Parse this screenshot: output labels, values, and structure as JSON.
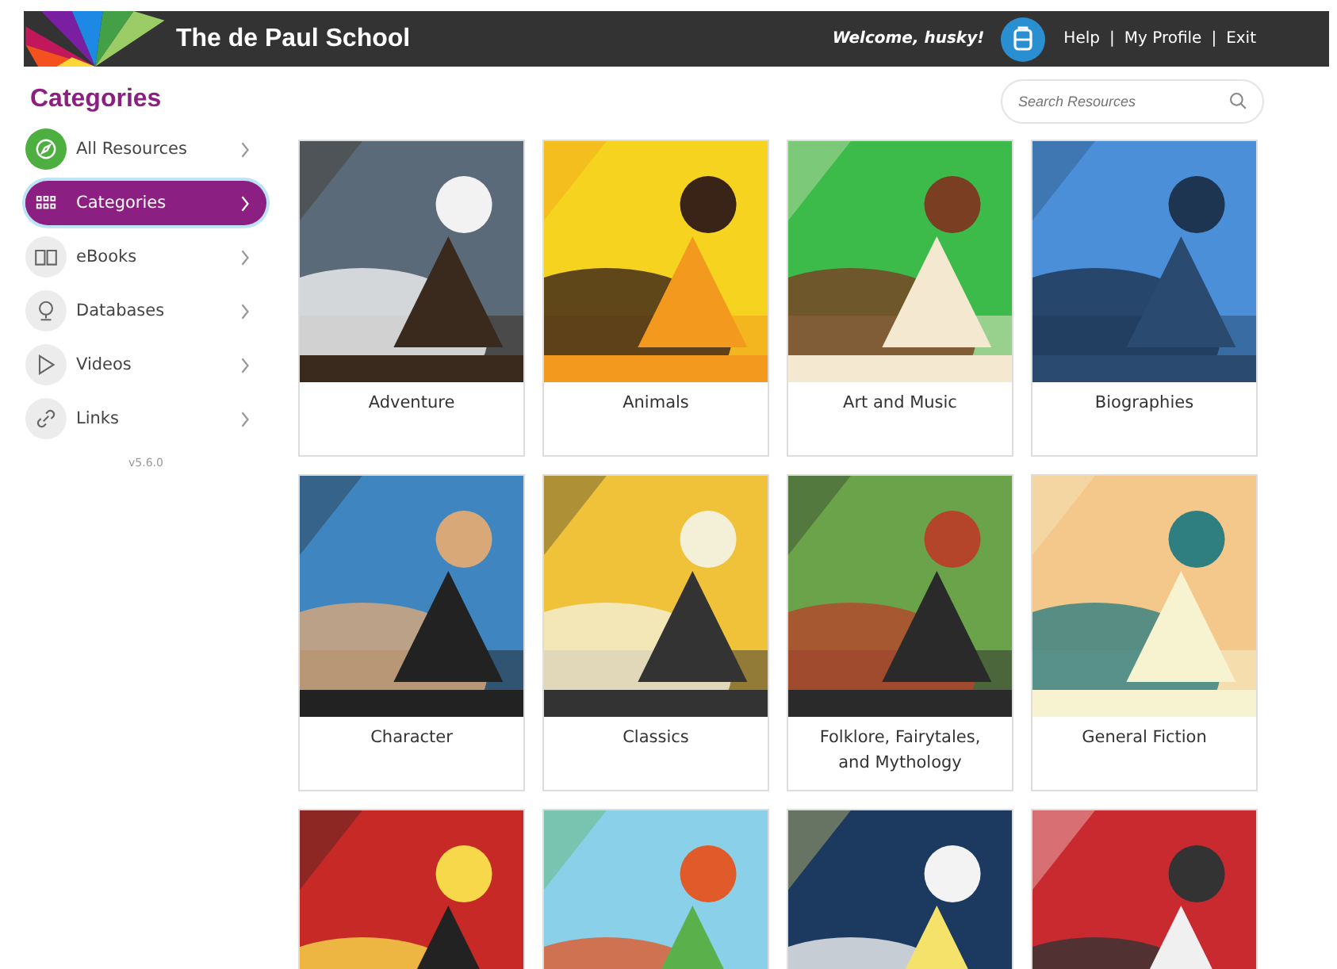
{
  "header": {
    "title": "The de Paul School",
    "welcome": "Welcome, husky!",
    "links": [
      "Help",
      "My Profile",
      "Exit"
    ],
    "separators": [
      "|",
      "|"
    ]
  },
  "sidebar": {
    "heading": "Categories",
    "items": [
      {
        "label": "All Resources",
        "selected": false,
        "color": "#4caf3f"
      },
      {
        "label": "Categories",
        "selected": true,
        "color": "#8c1f82"
      },
      {
        "label": "eBooks",
        "selected": false,
        "color": "#ececec"
      },
      {
        "label": "Databases",
        "selected": false,
        "color": "#ececec"
      },
      {
        "label": "Videos",
        "selected": false,
        "color": "#ececec"
      },
      {
        "label": "Links",
        "selected": false,
        "color": "#ececec"
      }
    ],
    "version": "v5.6.0"
  },
  "search": {
    "placeholder": "Search Resources"
  },
  "tiles": [
    {
      "kind": "picture",
      "title": "Adventure"
    },
    {
      "kind": "picture",
      "title": "Animals"
    },
    {
      "kind": "picture",
      "title": "Art and Music"
    },
    {
      "kind": "picture",
      "title": "Biographies"
    },
    {
      "kind": "picture",
      "title": "Character"
    },
    {
      "kind": "picture",
      "title": "Classics"
    },
    {
      "kind": "picture",
      "title": "Folklore, Fairytales, and Mythology"
    },
    {
      "kind": "picture",
      "title": "General Fiction"
    },
    {
      "kind": "picture"
    },
    {
      "kind": "picture"
    },
    {
      "kind": "picture"
    },
    {
      "kind": "picture"
    }
  ]
}
